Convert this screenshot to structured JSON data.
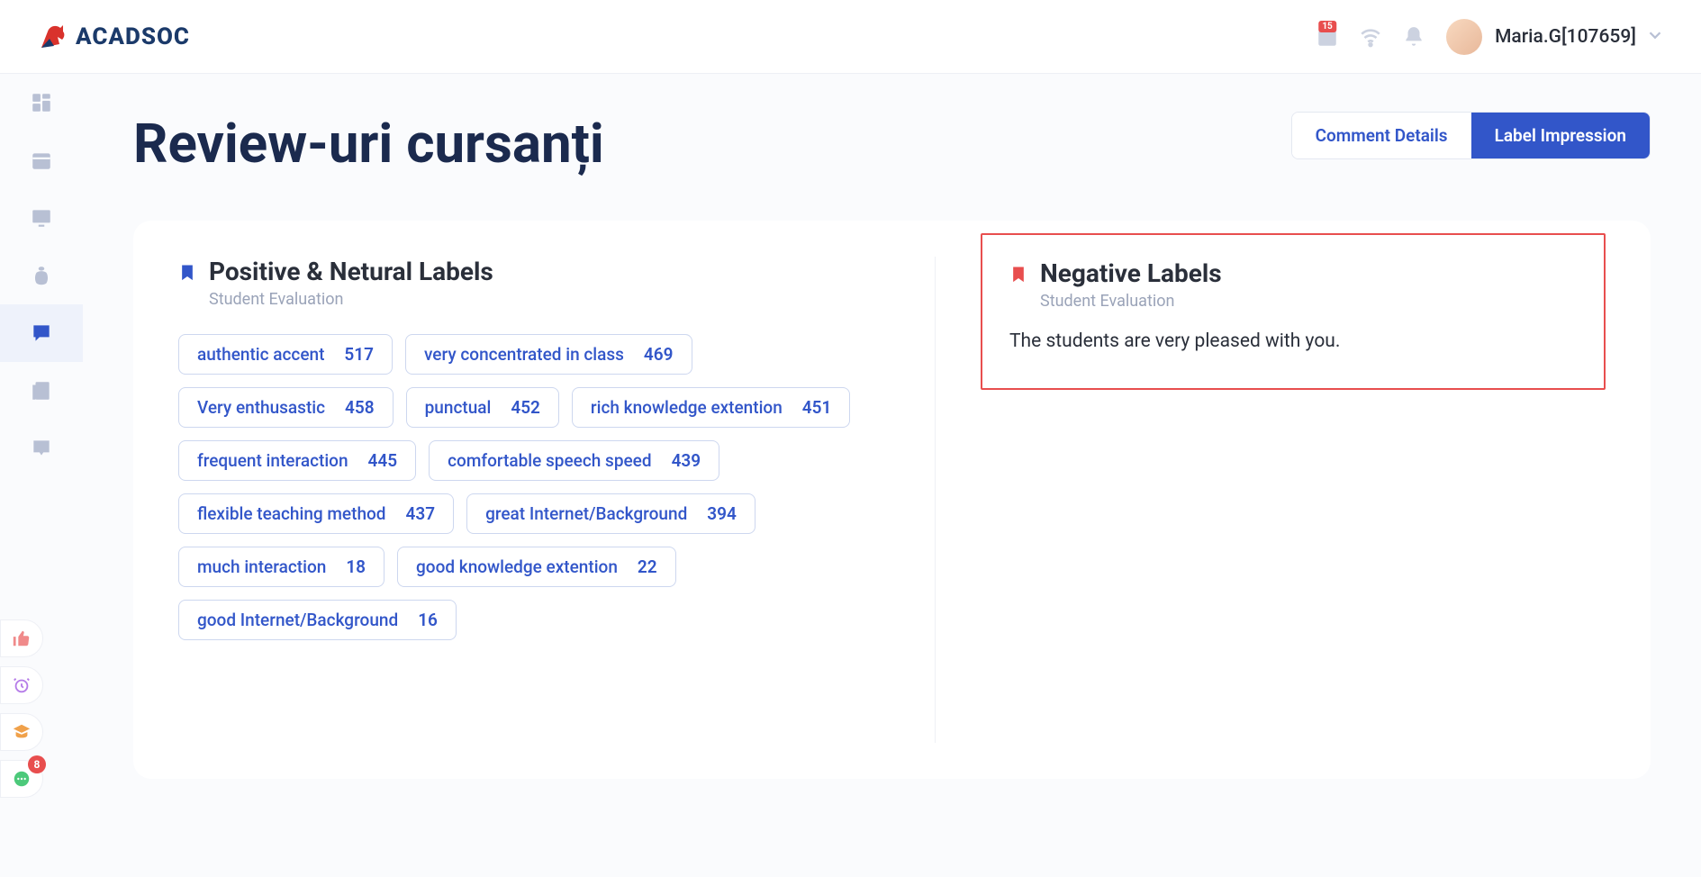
{
  "header": {
    "brand_text": "ACADSOC",
    "badge_15": "15",
    "user_name": "Maria.G[107659]"
  },
  "page": {
    "title": "Review-uri cursanți",
    "tab_comment": "Comment Details",
    "tab_label": "Label Impression"
  },
  "positive": {
    "title": "Positive & Netural Labels",
    "subtitle": "Student Evaluation",
    "labels": [
      {
        "text": "authentic accent",
        "count": "517"
      },
      {
        "text": "very concentrated in class",
        "count": "469"
      },
      {
        "text": "Very enthusastic",
        "count": "458"
      },
      {
        "text": "punctual",
        "count": "452"
      },
      {
        "text": "rich knowledge extention",
        "count": "451"
      },
      {
        "text": "frequent interaction",
        "count": "445"
      },
      {
        "text": "comfortable speech speed",
        "count": "439"
      },
      {
        "text": "flexible teaching method",
        "count": "437"
      },
      {
        "text": "great Internet/Background",
        "count": "394"
      },
      {
        "text": "much interaction",
        "count": "18"
      },
      {
        "text": "good knowledge extention",
        "count": "22"
      },
      {
        "text": "good Internet/Background",
        "count": "16"
      }
    ]
  },
  "negative": {
    "title": "Negative Labels",
    "subtitle": "Student Evaluation",
    "message": "The students are very pleased with you."
  },
  "float": {
    "chat_badge": "8"
  }
}
